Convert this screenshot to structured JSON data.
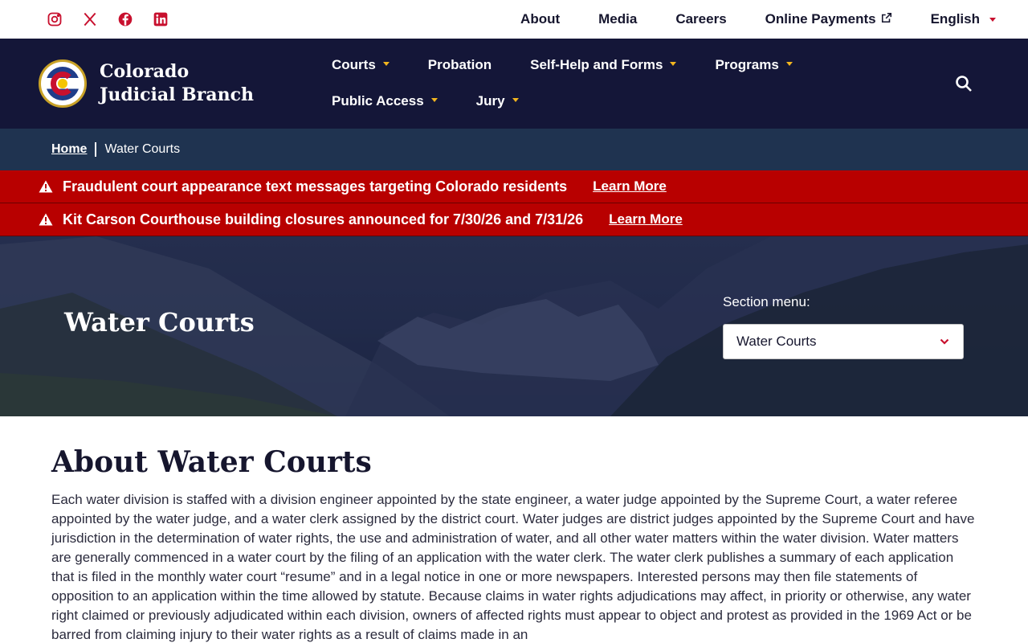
{
  "utility": {
    "social": [
      "instagram-icon",
      "x-icon",
      "facebook-icon",
      "linkedin-icon"
    ],
    "links": [
      "About",
      "Media",
      "Careers",
      "Online Payments"
    ],
    "language": "English"
  },
  "brand": {
    "name": "Colorado Judicial Branch"
  },
  "nav": {
    "items": [
      "Courts",
      "Probation",
      "Self-Help and Forms",
      "Programs",
      "Public Access",
      "Jury"
    ]
  },
  "breadcrumb": {
    "home": "Home",
    "current": "Water Courts"
  },
  "alerts": [
    {
      "text": "Fraudulent court appearance text messages targeting Colorado residents",
      "link": "Learn More"
    },
    {
      "text": "Kit Carson Courthouse building closures announced for 7/30/26 and 7/31/26",
      "link": "Learn More"
    }
  ],
  "hero": {
    "title": "Water Courts",
    "section_label": "Section menu:",
    "section_value": "Water Courts"
  },
  "content": {
    "heading": "About Water Courts",
    "body": "Each water division is staffed with a division engineer appointed by the state engineer, a water judge appointed by the Supreme Court, a water referee appointed by the water judge, and a water clerk assigned by the district court. Water judges are district judges appointed by the Supreme Court and have jurisdiction in the determination of water rights, the use and administration of water, and all other water matters within the water division. Water matters are generally commenced in a water court by the filing of an application with the water clerk. The water clerk publishes a summary of each application that is filed in the monthly water court “resume” and in a legal notice in one or more newspapers. Interested persons may then file statements of opposition to an application within the time allowed by statute. Because claims in water rights adjudications may affect, in priority or otherwise, any water right claimed or previously adjudicated within each division, owners of affected rights must appear to object and protest as provided in the 1969 Act or be barred from claiming injury to their water rights as a result of claims made in an"
  },
  "colors": {
    "navy": "#141638",
    "alert_red": "#b80000",
    "accent_red": "#c8102e",
    "gold": "#f2b51f",
    "breadcrumb_bg": "#1f3350"
  }
}
